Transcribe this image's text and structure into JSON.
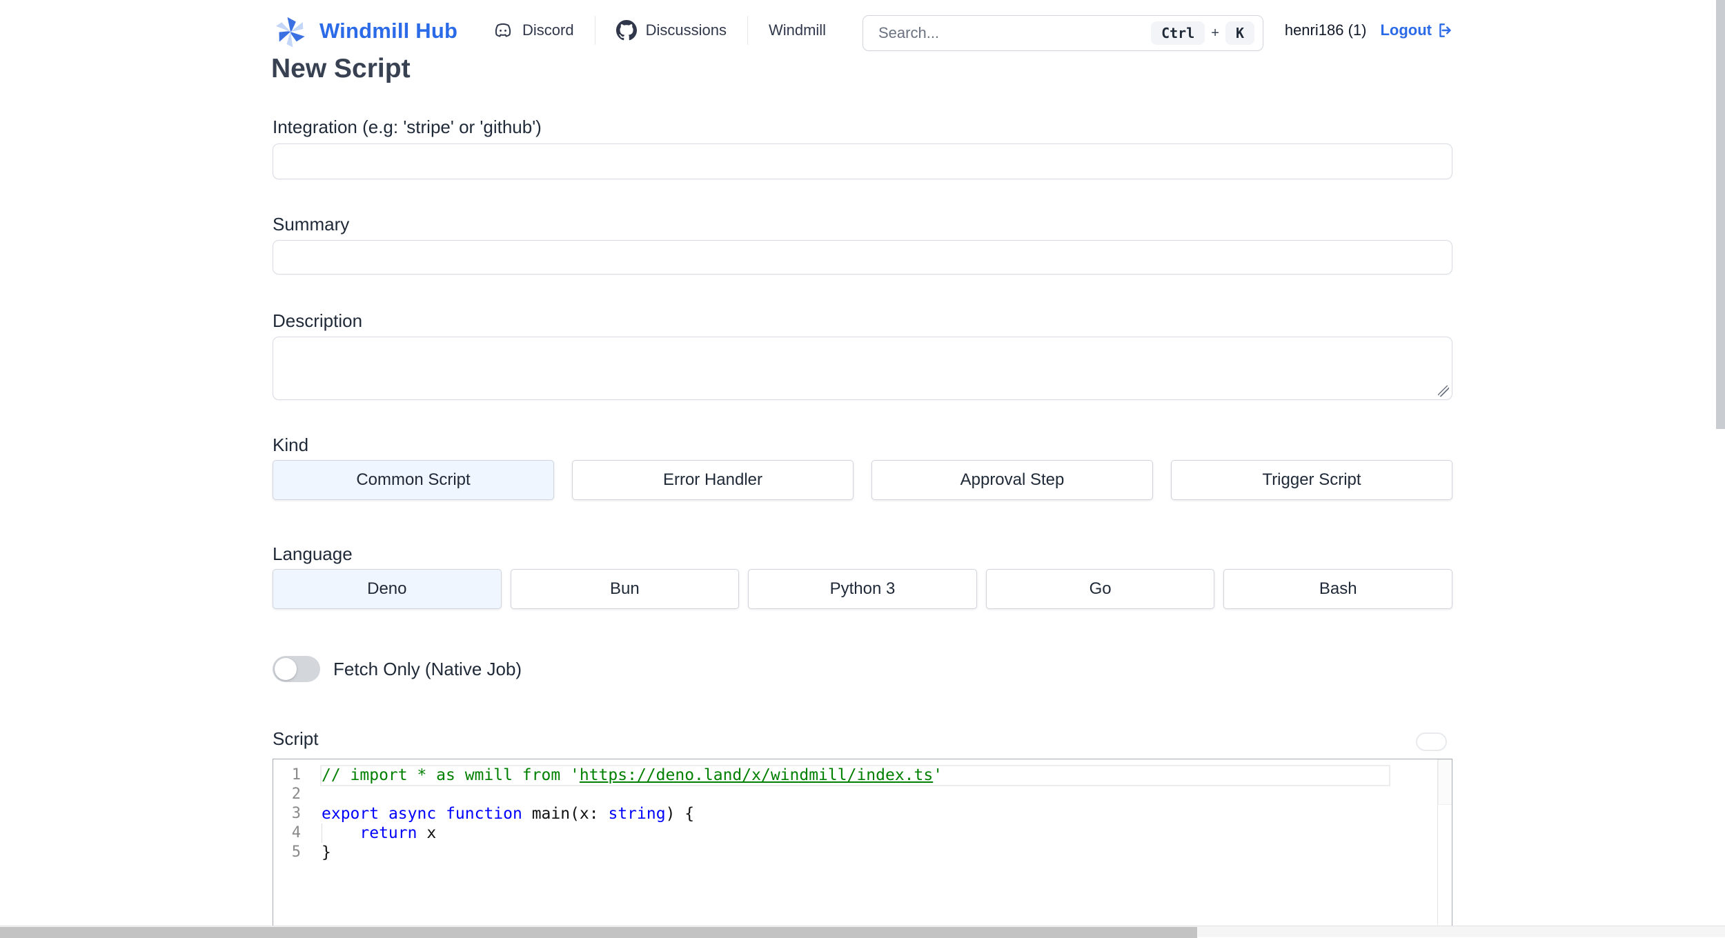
{
  "header": {
    "brand": "Windmill Hub",
    "nav": [
      {
        "label": "Discord"
      },
      {
        "label": "Discussions"
      },
      {
        "label": "Windmill"
      }
    ],
    "search": {
      "placeholder": "Search...",
      "shortcut_key1": "Ctrl",
      "shortcut_plus": "+",
      "shortcut_key2": "K"
    },
    "user_label": "henri186 (1)",
    "logout_label": "Logout"
  },
  "page": {
    "title": "New Script",
    "integration": {
      "label": "Integration (e.g: 'stripe' or 'github')",
      "value": ""
    },
    "summary": {
      "label": "Summary",
      "value": ""
    },
    "description": {
      "label": "Description",
      "value": ""
    },
    "kind": {
      "label": "Kind",
      "options": [
        "Common Script",
        "Error Handler",
        "Approval Step",
        "Trigger Script"
      ],
      "selected": "Common Script"
    },
    "language": {
      "label": "Language",
      "options": [
        "Deno",
        "Bun",
        "Python 3",
        "Go",
        "Bash"
      ],
      "selected": "Deno"
    },
    "fetch_only": {
      "label": "Fetch Only (Native Job)",
      "enabled": false
    },
    "script": {
      "label": "Script",
      "code_lines": [
        {
          "num": "1",
          "current": true,
          "tokens": [
            {
              "c": "comment",
              "t": "// import * as wmill from '"
            },
            {
              "c": "comment link",
              "t": "https://deno.land/x/windmill/index.ts"
            },
            {
              "c": "comment",
              "t": "'"
            }
          ]
        },
        {
          "num": "2",
          "tokens": []
        },
        {
          "num": "3",
          "tokens": [
            {
              "c": "keyword",
              "t": "export"
            },
            {
              "c": "plain",
              "t": " "
            },
            {
              "c": "keyword",
              "t": "async"
            },
            {
              "c": "plain",
              "t": " "
            },
            {
              "c": "keyword",
              "t": "function"
            },
            {
              "c": "plain",
              "t": " main(x: "
            },
            {
              "c": "keyword",
              "t": "string"
            },
            {
              "c": "plain",
              "t": ") {"
            }
          ]
        },
        {
          "num": "4",
          "tokens": [
            {
              "c": "plain",
              "t": "    "
            },
            {
              "c": "keyword",
              "t": "return"
            },
            {
              "c": "plain",
              "t": " x"
            }
          ]
        },
        {
          "num": "5",
          "tokens": [
            {
              "c": "plain",
              "t": "}"
            }
          ]
        }
      ]
    }
  },
  "colors": {
    "brand_blue": "#2b6be8",
    "logo_dark_blue": "#3b70e3",
    "logo_light_blue": "#c3d6f7",
    "selected_bg": "#eff6ff",
    "keyword": "#0000ff",
    "comment": "#008000",
    "code_plain": "#111111",
    "line_number": "#8a8a8a"
  }
}
